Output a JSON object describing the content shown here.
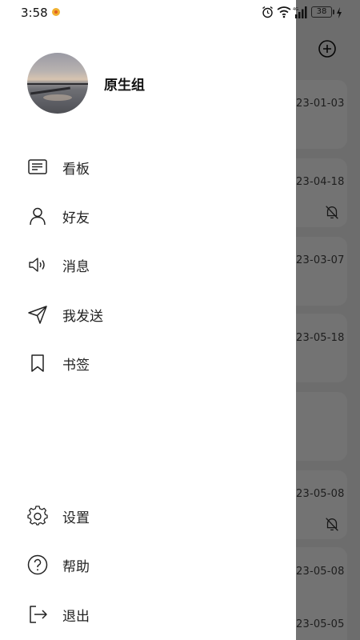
{
  "status_bar": {
    "time": "3:58",
    "battery": "38"
  },
  "profile": {
    "name": "原生组"
  },
  "menu": {
    "items": [
      {
        "label": "看板",
        "icon": "board-icon"
      },
      {
        "label": "好友",
        "icon": "person-icon"
      },
      {
        "label": "消息",
        "icon": "speaker-icon"
      },
      {
        "label": "我发送",
        "icon": "send-icon"
      },
      {
        "label": "书签",
        "icon": "bookmark-icon"
      }
    ],
    "bottom": [
      {
        "label": "设置",
        "icon": "gear-icon"
      },
      {
        "label": "帮助",
        "icon": "help-icon"
      },
      {
        "label": "退出",
        "icon": "logout-icon"
      }
    ]
  },
  "background_list": {
    "dates": [
      "23-01-03",
      "23-04-18",
      "23-03-07",
      "23-05-18",
      "23-05-08",
      "23-05-08",
      "23-05-05"
    ]
  }
}
